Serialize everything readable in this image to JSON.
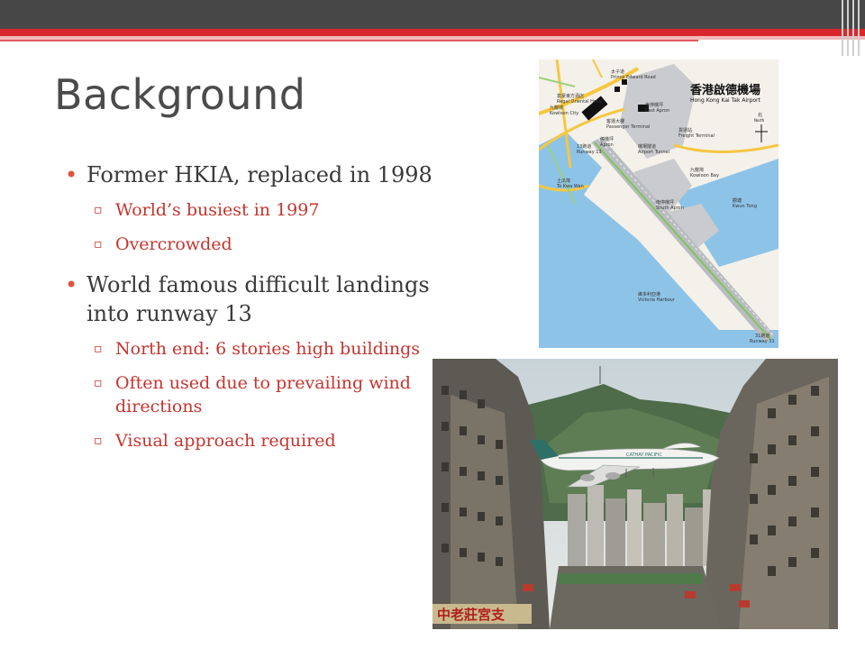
{
  "slide": {
    "title": "Background",
    "bullets": [
      {
        "text": "Former HKIA, replaced in 1998",
        "sub": [
          "World’s busiest in 1997",
          "Overcrowded"
        ]
      },
      {
        "text": "World famous difficult landings into runway 13",
        "sub": [
          "North end: 6 stories high buildings",
          "Often used due to prevailing wind directions",
          "Visual approach required"
        ]
      }
    ],
    "bullet_glyph": "•",
    "sub_glyph": "▫"
  },
  "map": {
    "title_zh": "香港啟德機場",
    "title_en": "Hong Kong Kai Tak Airport",
    "north_zh": "北",
    "north_en": "North",
    "labels": [
      {
        "zh": "太子道",
        "en": "Prince Edward Road"
      },
      {
        "zh": "富豪東方酒店",
        "en": "Regal Oriental Hotel"
      },
      {
        "zh": "九龍城",
        "en": "Kowloon City"
      },
      {
        "zh": "東停機坪",
        "en": "East Apron"
      },
      {
        "zh": "客運大樓",
        "en": "Passenger Terminal"
      },
      {
        "zh": "停機坪",
        "en": "Apron"
      },
      {
        "zh": "貨運站",
        "en": "Freight Terminal"
      },
      {
        "zh": "13跑道",
        "en": "Runway 13"
      },
      {
        "zh": "機場隧道",
        "en": "Airport Tunnel"
      },
      {
        "zh": "九龍灣",
        "en": "Kowloon Bay"
      },
      {
        "zh": "土瓜灣",
        "en": "To Kwa Wan"
      },
      {
        "zh": "南停機坪",
        "en": "South Apron"
      },
      {
        "zh": "觀塘",
        "en": "Kwun Tong"
      },
      {
        "zh": "維多利亞港",
        "en": "Victoria Harbour"
      },
      {
        "zh": "31跑道",
        "en": "Runway 31"
      }
    ]
  },
  "photo": {
    "airline_text": "CATHAY PACIFIC",
    "sign_text": "中老莊宮支"
  },
  "colors": {
    "title": "#4b4b4b",
    "body": "#3a3a3a",
    "accent": "#c4342f",
    "bar_dark": "#474747",
    "bar_red": "#d8262c",
    "water": "#8ec3e8"
  }
}
